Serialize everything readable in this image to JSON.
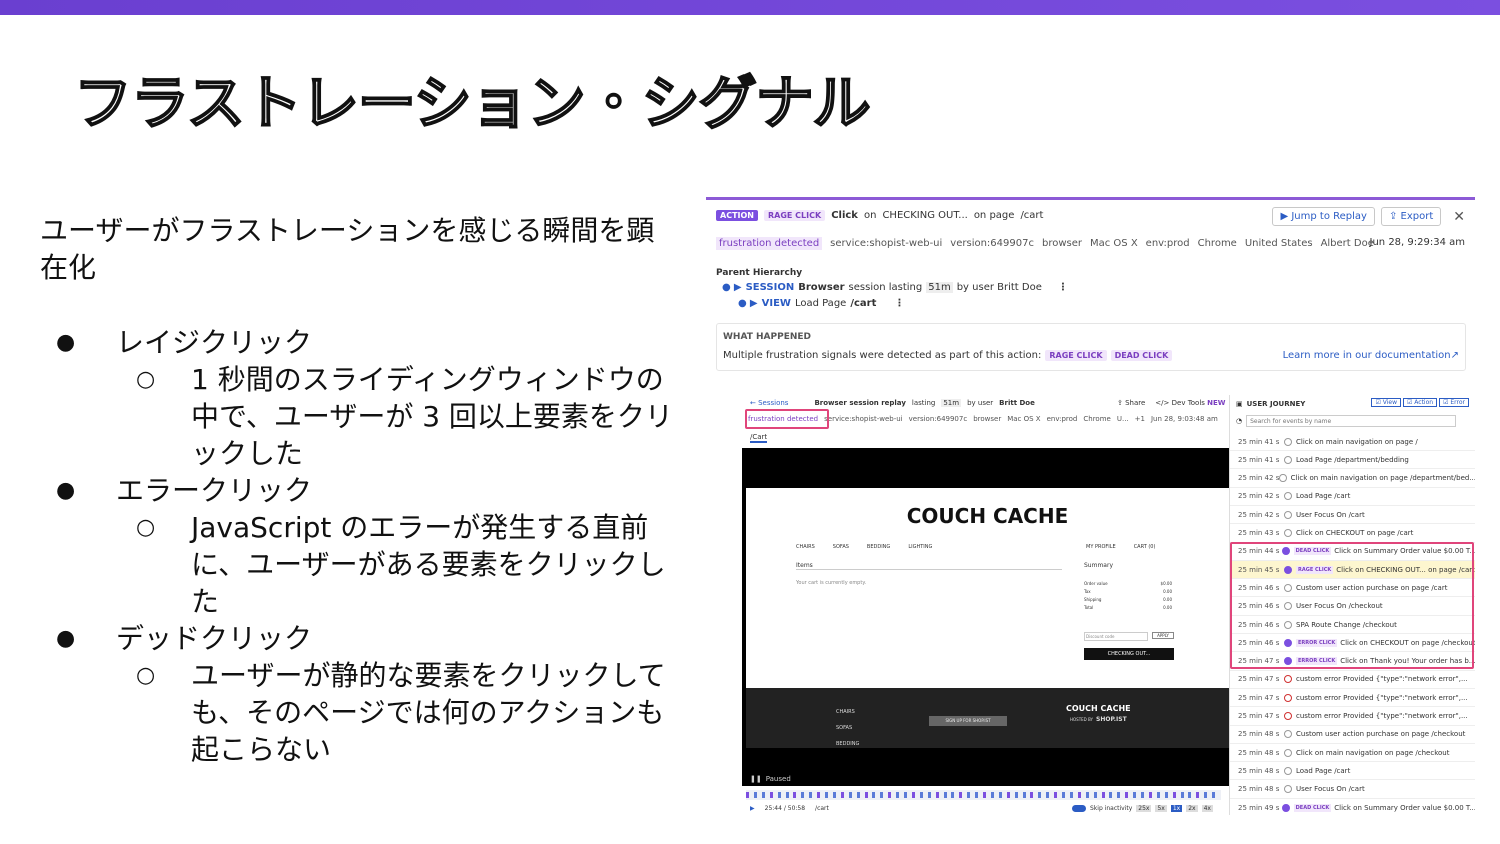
{
  "slide": {
    "title": "フラストレーション・シグナル",
    "lead": "ユーザーがフラストレーションを感じる瞬間を顕在化",
    "bullets": [
      {
        "label": "レイジクリック",
        "sub": "1 秒間のスライディングウィンドウの中で、ユーザーが 3 回以上要素をクリックした"
      },
      {
        "label": "エラークリック",
        "sub": "JavaScript のエラーが発生する直前に、ユーザーがある要素をクリックした"
      },
      {
        "label": "デッドクリック",
        "sub": "ユーザーが静的な要素をクリックしても、そのページでは何のアクションも起こらない"
      }
    ],
    "bullet_glyph": "●",
    "sub_glyph": "○"
  },
  "panel": {
    "action_badge": "ACTION",
    "rage_badge": "RAGE CLICK",
    "click": "Click",
    "on": "on",
    "target": "CHECKING OUT...",
    "on_page": "on page",
    "page": "/cart",
    "jump": "Jump to Replay",
    "export": "Export",
    "tags": [
      "frustration detected",
      "service:shopist-web-ui",
      "version:649907c",
      "browser",
      "Mac OS X",
      "env:prod",
      "Chrome",
      "United States",
      "Albert Doe"
    ],
    "time": "Jun 28, 9:29:34 am",
    "hierarchy_title": "Parent Hierarchy",
    "session_label": "SESSION",
    "session_text": "Browser",
    "session_rest": "session lasting",
    "session_len": "51m",
    "session_user": "by user Britt Doe",
    "view_label": "VIEW",
    "view_text": "Load Page",
    "view_page": "/cart",
    "happened_title": "WHAT HAPPENED",
    "happened_text": "Multiple frustration signals were detected as part of this action:",
    "happened_b1": "RAGE CLICK",
    "happened_b2": "DEAD CLICK",
    "learn": "Learn more in our documentation"
  },
  "replay": {
    "sessions": "← Sessions",
    "title": "Browser session replay",
    "lasting": "lasting",
    "len": "51m",
    "by": "by user",
    "user": "Britt Doe",
    "share": "Share",
    "devtools": "Dev Tools",
    "new": "NEW",
    "tags": [
      "frustration detected",
      "service:shopist-web-ui",
      "version:649907c",
      "browser",
      "Mac OS X",
      "env:prod",
      "Chrome",
      "U...",
      "+1",
      "Jun 28, 9:03:48 am"
    ],
    "url": "/Cart",
    "store_name": "COUCH CACHE",
    "nav": [
      "CHAIRS",
      "SOFAS",
      "BEDDING",
      "LIGHTING"
    ],
    "nav_right": [
      "MY PROFILE",
      "CART (0)"
    ],
    "items": "Items",
    "empty": "Your cart is currently empty.",
    "summary": "Summary",
    "summary_rows": [
      [
        "Order value",
        "$0.00"
      ],
      [
        "Tax",
        "0.00"
      ],
      [
        "Shipping",
        "0.00"
      ],
      [
        "Total",
        "0.00"
      ]
    ],
    "discount": "Discount code",
    "apply": "APPLY",
    "checkout": "CHECKING OUT...",
    "footer_nav": [
      "CHAIRS",
      "SOFAS",
      "BEDDING"
    ],
    "signup": "SIGN UP FOR SHOP.IST",
    "footer_brand": "COUCH CACHE",
    "hosted": "HOSTED BY",
    "shopist": "SHOP.IST",
    "paused": "Paused",
    "timecode": "25:44 / 50:58",
    "cart": "/cart",
    "skip": "Skip inactivity",
    "speeds": [
      "25x",
      "5x",
      "1x",
      "2x",
      "4x"
    ],
    "journey_title": "USER JOURNEY",
    "filters": [
      "View",
      "Action",
      "Error"
    ],
    "search_placeholder": "Search for events by name",
    "events": [
      {
        "t": "25 min 41 s",
        "kind": "action",
        "text": "Click on main navigation on page /"
      },
      {
        "t": "25 min 41 s",
        "kind": "view",
        "text": "Load Page /department/bedding"
      },
      {
        "t": "25 min 42 s",
        "kind": "action",
        "text": "Click on main navigation on page /department/bed..."
      },
      {
        "t": "25 min 42 s",
        "kind": "view",
        "text": "Load Page /cart"
      },
      {
        "t": "25 min 42 s",
        "kind": "view",
        "text": "User Focus On /cart"
      },
      {
        "t": "25 min 43 s",
        "kind": "action",
        "text": "Click on CHECKOUT on page /cart"
      },
      {
        "t": "25 min 44 s",
        "kind": "frust",
        "badge": "DEAD CLICK",
        "text": "Click on Summary Order value $0.00 T..."
      },
      {
        "t": "25 min 45 s",
        "kind": "frust",
        "badge": "RAGE CLICK",
        "text": "Click on CHECKING OUT... on page /cart"
      },
      {
        "t": "25 min 46 s",
        "kind": "action",
        "text": "Custom user action purchase on page /cart"
      },
      {
        "t": "25 min 46 s",
        "kind": "view",
        "text": "User Focus On /checkout"
      },
      {
        "t": "25 min 46 s",
        "kind": "view",
        "text": "SPA Route Change /checkout"
      },
      {
        "t": "25 min 46 s",
        "kind": "frust",
        "badge": "ERROR CLICK",
        "text": "Click on CHECKOUT on page /checkout"
      },
      {
        "t": "25 min 47 s",
        "kind": "frust",
        "badge": "ERROR CLICK",
        "text": "Click on Thank you! Your order has b..."
      },
      {
        "t": "25 min 47 s",
        "kind": "error",
        "text": "custom error Provided {\"type\":\"network error\",..."
      },
      {
        "t": "25 min 47 s",
        "kind": "error",
        "text": "custom error Provided {\"type\":\"network error\",..."
      },
      {
        "t": "25 min 47 s",
        "kind": "error",
        "text": "custom error Provided {\"type\":\"network error\",..."
      },
      {
        "t": "25 min 48 s",
        "kind": "action",
        "text": "Custom user action purchase on page /checkout"
      },
      {
        "t": "25 min 48 s",
        "kind": "action",
        "text": "Click on main navigation on page /checkout"
      },
      {
        "t": "25 min 48 s",
        "kind": "view",
        "text": "Load Page /cart"
      },
      {
        "t": "25 min 48 s",
        "kind": "view",
        "text": "User Focus On /cart"
      },
      {
        "t": "25 min 49 s",
        "kind": "frust",
        "badge": "DEAD CLICK",
        "text": "Click on Summary Order value $0.00 T..."
      }
    ]
  }
}
